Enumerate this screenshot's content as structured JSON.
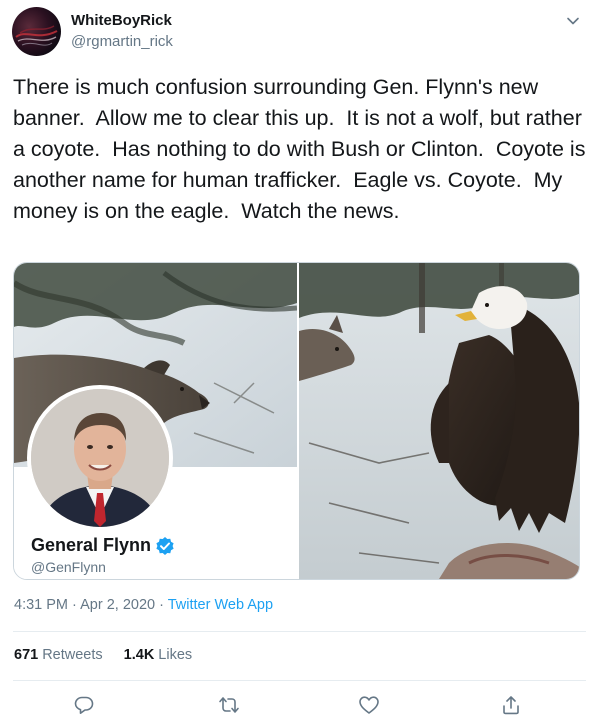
{
  "user": {
    "display_name": "WhiteBoyRick",
    "handle": "@rgmartin_rick"
  },
  "tweet": {
    "text": "There is much confusion surrounding Gen. Flynn's new banner.  Allow me to clear this up.  It is not a wolf, but rather a coyote.  Has nothing to do with Bush or Clinton.  Coyote is another name for human trafficker.  Eagle vs. Coyote.  My money is on the eagle.  Watch the news."
  },
  "media": {
    "profile_card": {
      "name": "General Flynn",
      "handle": "@GenFlynn",
      "verified": true
    }
  },
  "meta": {
    "time": "4:31 PM",
    "separator": "·",
    "date": "Apr 2, 2020",
    "source": "Twitter Web App"
  },
  "stats": {
    "retweets_count": "671",
    "retweets_label": "Retweets",
    "likes_count": "1.4K",
    "likes_label": "Likes"
  },
  "icons": {
    "caret": "chevron-down-icon",
    "reply": "reply-icon",
    "retweet": "retweet-icon",
    "like": "heart-icon",
    "share": "share-icon",
    "verified": "verified-badge-icon"
  },
  "colors": {
    "text": "#14171a",
    "secondary": "#657786",
    "link": "#1da1f2",
    "border": "#e6ecf0"
  }
}
